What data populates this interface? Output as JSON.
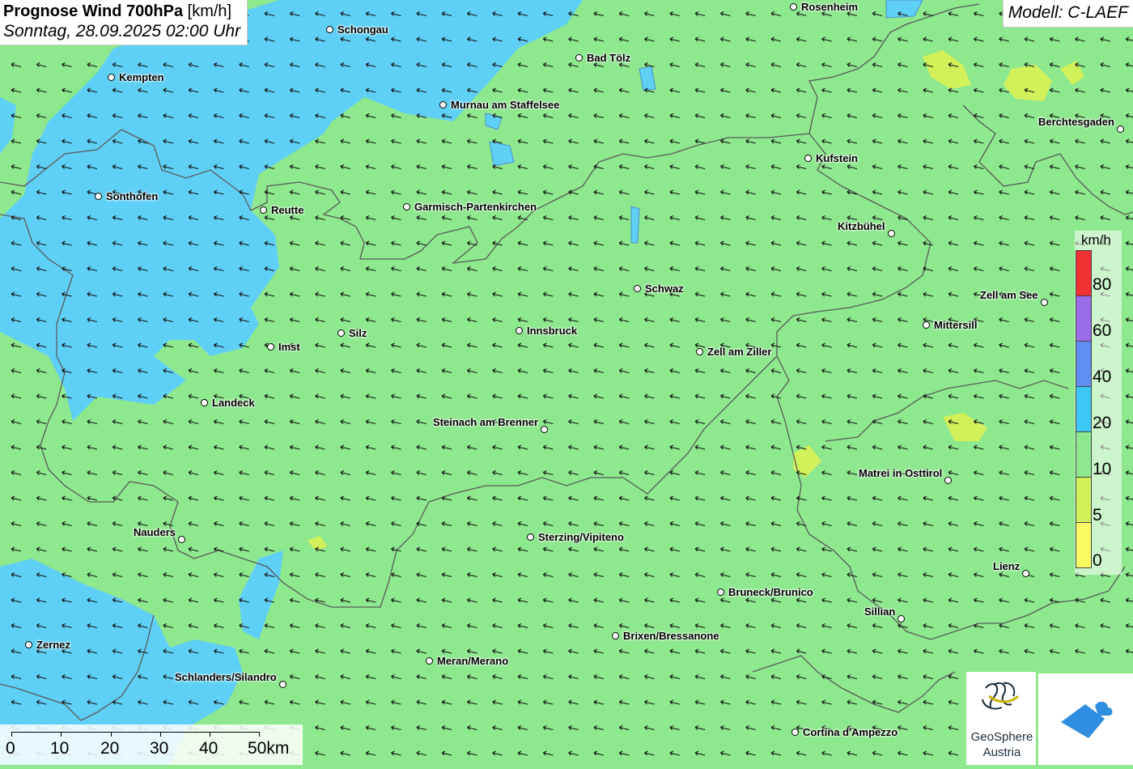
{
  "title": {
    "bold": "Prognose Wind 700hPa",
    "unit": "[km/h]",
    "datetime": "Sonntag, 28.09.2025 02:00 Uhr"
  },
  "model": "Modell: C-LAEF",
  "legend": {
    "unit": "km/h",
    "labels": [
      "80",
      "60",
      "40",
      "20",
      "10",
      "5",
      "0"
    ],
    "colors": [
      "#f03232",
      "#9b6be8",
      "#5f8df0",
      "#3cc8f5",
      "#8ee88e",
      "#d2f05a",
      "#fafa64"
    ]
  },
  "scale": {
    "labels": [
      "0",
      "10",
      "20",
      "30",
      "40",
      "50km"
    ]
  },
  "branding": {
    "name": "GeoSphere",
    "country": "Austria"
  },
  "cities": [
    {
      "name": "Rosenheim",
      "label_side": "right"
    },
    {
      "name": "Schongau",
      "label_side": "right"
    },
    {
      "name": "Bad Tölz",
      "label_side": "right"
    },
    {
      "name": "Kempten",
      "label_side": "right"
    },
    {
      "name": "Murnau am Staffelsee",
      "label_side": "right"
    },
    {
      "name": "Berchtesgaden",
      "label_side": "left"
    },
    {
      "name": "Kufstein",
      "label_side": "right"
    },
    {
      "name": "Sonthofen",
      "label_side": "right"
    },
    {
      "name": "Reutte",
      "label_side": "right"
    },
    {
      "name": "Garmisch-Partenkirchen",
      "label_side": "right"
    },
    {
      "name": "Kitzbühel",
      "label_side": "left"
    },
    {
      "name": "Schwaz",
      "label_side": "right"
    },
    {
      "name": "Zell am See",
      "label_side": "left"
    },
    {
      "name": "Mittersill",
      "label_side": "right"
    },
    {
      "name": "Silz",
      "label_side": "right"
    },
    {
      "name": "Innsbruck",
      "label_side": "right"
    },
    {
      "name": "Imst",
      "label_side": "right"
    },
    {
      "name": "Zell am Ziller",
      "label_side": "right"
    },
    {
      "name": "Landeck",
      "label_side": "right"
    },
    {
      "name": "Steinach am Brenner",
      "label_side": "left"
    },
    {
      "name": "Matrei in Osttirol",
      "label_side": "left"
    },
    {
      "name": "Nauders",
      "label_side": "left"
    },
    {
      "name": "Sterzing/Vipiteno",
      "label_side": "right"
    },
    {
      "name": "Lienz",
      "label_side": "left"
    },
    {
      "name": "Bruneck/Brunico",
      "label_side": "right"
    },
    {
      "name": "Sillian",
      "label_side": "left"
    },
    {
      "name": "Brixen/Bressanone",
      "label_side": "right"
    },
    {
      "name": "Zernez",
      "label_side": "right"
    },
    {
      "name": "Meran/Merano",
      "label_side": "right"
    },
    {
      "name": "Schlanders/Silandro",
      "label_side": "left"
    },
    {
      "name": "Cortina d'Ampezzo",
      "label_side": "right"
    }
  ],
  "colors": {
    "low_wind": "#8ee88e",
    "mid_wind": "#5fd0f5",
    "very_low_wind": "#d2f05a",
    "border": "#5a5a5a"
  }
}
